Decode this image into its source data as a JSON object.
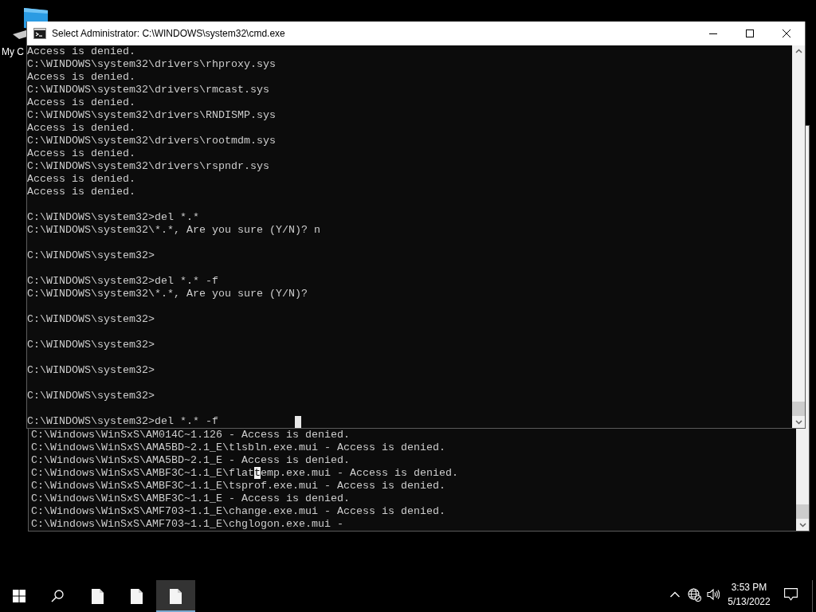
{
  "desktop_icons": [
    {
      "label": "My C"
    }
  ],
  "back_window": {
    "lines": [
      {
        "segments": [
          {
            "text": "C:\\Windows\\WinSxS\\AM014C~1.126 - Access is denied.",
            "selected": false
          }
        ]
      },
      {
        "segments": [
          {
            "text": "C:\\Windows\\WinSxS\\AMA5BD~2.1_E\\tlsbln.exe.mui - Access is denied.",
            "selected": false
          }
        ]
      },
      {
        "segments": [
          {
            "text": "C:\\Windows\\WinSxS\\AMA5BD~2.1_E - Access is denied.",
            "selected": false
          }
        ]
      },
      {
        "segments": [
          {
            "text": "C:\\Windows\\WinSxS\\AMBF3C~1.1_E\\flat",
            "selected": false
          },
          {
            "text": "t",
            "selected": true
          },
          {
            "text": "emp.exe.mui - Access is denied.",
            "selected": false
          }
        ]
      },
      {
        "segments": [
          {
            "text": "C:\\Windows\\WinSxS\\AMBF3C~1.1_E\\tsprof.exe.mui - Access is denied.",
            "selected": false
          }
        ]
      },
      {
        "segments": [
          {
            "text": "C:\\Windows\\WinSxS\\AMBF3C~1.1_E - Access is denied.",
            "selected": false
          }
        ]
      },
      {
        "segments": [
          {
            "text": "C:\\Windows\\WinSxS\\AMF703~1.1_E\\change.exe.mui - Access is denied.",
            "selected": false
          }
        ]
      },
      {
        "segments": [
          {
            "text": "C:\\Windows\\WinSxS\\AMF703~1.1_E\\chglogon.exe.mui -",
            "selected": false
          }
        ]
      }
    ]
  },
  "front_window": {
    "title": "Select Administrator: C:\\WINDOWS\\system32\\cmd.exe",
    "lines": [
      {
        "kind": "text",
        "text": "Access is denied.",
        "cursor": false
      },
      {
        "kind": "text",
        "text": "C:\\WINDOWS\\system32\\drivers\\rhproxy.sys",
        "cursor": false
      },
      {
        "kind": "text",
        "text": "Access is denied.",
        "cursor": false
      },
      {
        "kind": "text",
        "text": "C:\\WINDOWS\\system32\\drivers\\rmcast.sys",
        "cursor": false
      },
      {
        "kind": "text",
        "text": "Access is denied.",
        "cursor": false
      },
      {
        "kind": "text",
        "text": "C:\\WINDOWS\\system32\\drivers\\RNDISMP.sys",
        "cursor": false
      },
      {
        "kind": "text",
        "text": "Access is denied.",
        "cursor": false
      },
      {
        "kind": "text",
        "text": "C:\\WINDOWS\\system32\\drivers\\rootmdm.sys",
        "cursor": false
      },
      {
        "kind": "text",
        "text": "Access is denied.",
        "cursor": false
      },
      {
        "kind": "text",
        "text": "C:\\WINDOWS\\system32\\drivers\\rspndr.sys",
        "cursor": false
      },
      {
        "kind": "text",
        "text": "Access is denied.",
        "cursor": false
      },
      {
        "kind": "text",
        "text": "Access is denied.",
        "cursor": false
      },
      {
        "kind": "blank",
        "cursor": false
      },
      {
        "kind": "text",
        "text": "C:\\WINDOWS\\system32>del *.*",
        "cursor": false
      },
      {
        "kind": "text",
        "text": "C:\\WINDOWS\\system32\\*.*, Are you sure (Y/N)? n",
        "cursor": false
      },
      {
        "kind": "blank",
        "cursor": false
      },
      {
        "kind": "text",
        "text": "C:\\WINDOWS\\system32>",
        "cursor": false
      },
      {
        "kind": "blank",
        "cursor": false
      },
      {
        "kind": "text",
        "text": "C:\\WINDOWS\\system32>del *.* -f",
        "cursor": false
      },
      {
        "kind": "text",
        "text": "C:\\WINDOWS\\system32\\*.*, Are you sure (Y/N)?",
        "cursor": false
      },
      {
        "kind": "blank",
        "cursor": false
      },
      {
        "kind": "text",
        "text": "C:\\WINDOWS\\system32>",
        "cursor": false
      },
      {
        "kind": "blank",
        "cursor": false
      },
      {
        "kind": "text",
        "text": "C:\\WINDOWS\\system32>",
        "cursor": false
      },
      {
        "kind": "blank",
        "cursor": false
      },
      {
        "kind": "text",
        "text": "C:\\WINDOWS\\system32>",
        "cursor": false
      },
      {
        "kind": "blank",
        "cursor": false
      },
      {
        "kind": "text",
        "text": "C:\\WINDOWS\\system32>",
        "cursor": false
      },
      {
        "kind": "blank",
        "cursor": false
      },
      {
        "kind": "text",
        "text": "C:\\WINDOWS\\system32>del *.* -f",
        "cursor": true
      }
    ]
  },
  "taskbar": {
    "apps": [
      {
        "selected": false
      },
      {
        "selected": false
      },
      {
        "selected": true
      }
    ],
    "clock": {
      "time": "3:53 PM",
      "date": "5/13/2022"
    }
  }
}
